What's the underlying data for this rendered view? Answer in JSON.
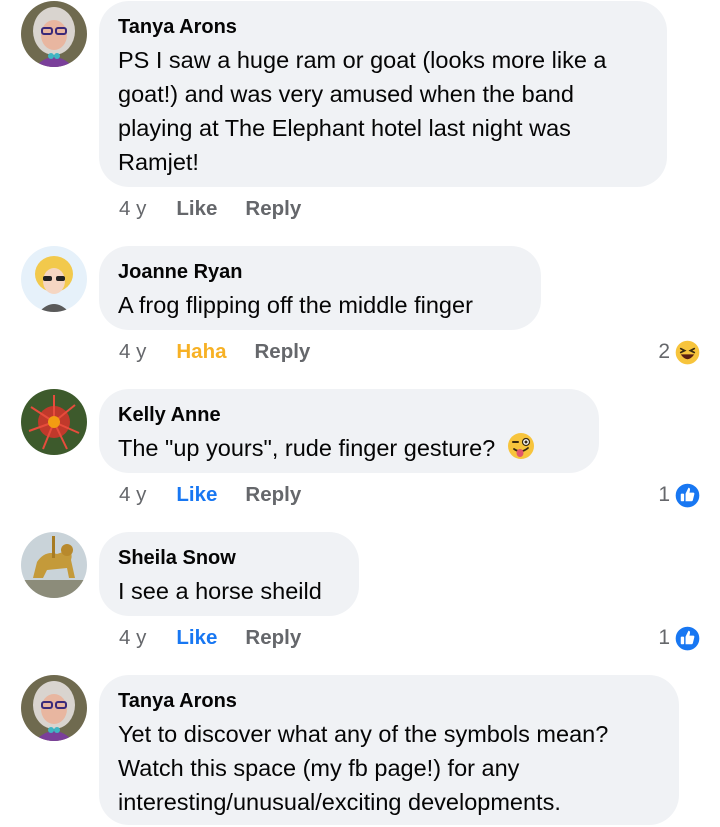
{
  "comments": [
    {
      "author": "Tanya Arons",
      "lines": [
        "PS I saw a huge ram or goat (looks more like a",
        "goat!) and was very amused when the band",
        "playing at The Elephant hotel last night was",
        "Ramjet!"
      ],
      "time": "4 y",
      "reaction_action": "Like",
      "reply": "Reply",
      "avatar": "woman-glasses-avatar"
    },
    {
      "author": "Joanne Ryan",
      "lines": [
        "A frog flipping off the middle finger"
      ],
      "time": "4 y",
      "reaction_action": "Haha",
      "reply": "Reply",
      "reaction_count": "2",
      "reaction_icon": "haha-emoji-icon",
      "avatar": "cartoon-woman-avatar"
    },
    {
      "author": "Kelly Anne",
      "lines": [
        "The \"up yours\", rude finger gesture?"
      ],
      "time": "4 y",
      "reaction_action": "Like",
      "reply": "Reply",
      "reaction_count": "1",
      "reaction_icon": "like-thumb-icon",
      "inline_emoji": "winking-tongue-emoji",
      "avatar": "red-flower-avatar"
    },
    {
      "author": "Sheila Snow",
      "lines": [
        "I see a horse sheild"
      ],
      "time": "4 y",
      "reaction_action": "Like",
      "reply": "Reply",
      "reaction_count": "1",
      "reaction_icon": "like-thumb-icon",
      "avatar": "golden-lion-statue-avatar"
    },
    {
      "author": "Tanya Arons",
      "lines": [
        "Yet to discover what any of the symbols mean?",
        "Watch this space (my fb page!) for any",
        "interesting/unusual/exciting developments."
      ],
      "avatar": "woman-glasses-avatar"
    }
  ],
  "colors": {
    "bubble": "#f0f2f5",
    "meta": "#65676b",
    "like_blue": "#1877f2",
    "haha_yellow": "#f7b125"
  }
}
